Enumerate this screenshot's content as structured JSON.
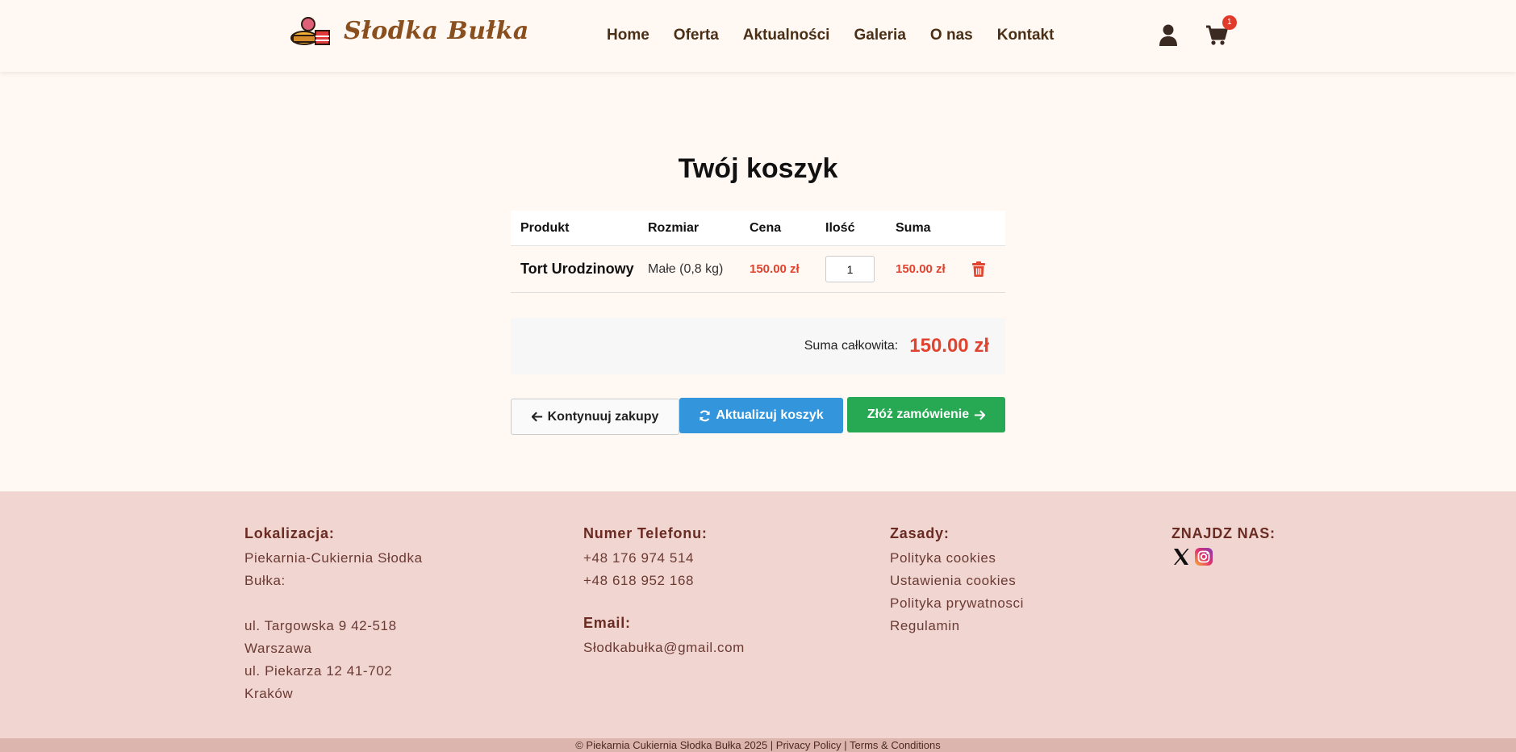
{
  "brand": {
    "name": "Słodka Bułka"
  },
  "nav": {
    "items": [
      "Home",
      "Oferta",
      "Aktualności",
      "Galeria",
      "O nas",
      "Kontakt"
    ]
  },
  "header": {
    "cart_count": "1"
  },
  "cart": {
    "title": "Twój koszyk",
    "columns": {
      "product": "Produkt",
      "size": "Rozmiar",
      "price": "Cena",
      "qty": "Ilość",
      "sum": "Suma"
    },
    "items": [
      {
        "name": "Tort Urodzinowy",
        "size": "Małe (0,8 kg)",
        "price": "150.00 zł",
        "qty": "1",
        "sum": "150.00 zł"
      }
    ],
    "total_label": "Suma całkowita:",
    "total_value": "150.00 zł",
    "buttons": {
      "continue": "Kontynuuj zakupy",
      "update": "Aktualizuj koszyk",
      "order": "Złóż zamówienie"
    }
  },
  "footer": {
    "location": {
      "heading": "Lokalizacja:",
      "lines": [
        "Piekarnia-Cukiernia Słodka",
        "Bułka:",
        "ul. Targowska 9 42-518",
        "Warszawa",
        "ul. Piekarza 12 41-702",
        "Kraków"
      ]
    },
    "phone": {
      "heading": "Numer Telefonu:",
      "lines": [
        "+48 176 974 514",
        "+48 618 952 168"
      ],
      "email_heading": "Email:",
      "email": "Słodkabułka@gmail.com"
    },
    "rules": {
      "heading": "Zasady:",
      "links": [
        "Polityka cookies",
        "Ustawienia cookies",
        "Polityka prywatnosci",
        "Regulamin"
      ]
    },
    "social": {
      "heading": "ZNAJDZ NAS:"
    },
    "copyright": "© Piekarnia Cukiernia Słodka Bułka 2025 | Privacy Policy | Terms & Conditions"
  },
  "colors": {
    "accent_red": "#e0442f",
    "update_blue": "#3396dc",
    "order_green": "#27a852",
    "footer_bg": "#f0d5d1",
    "brand_brown": "#8a4f1e"
  },
  "icons": [
    "bakery-logo-icon",
    "user-icon",
    "cart-icon",
    "trash-icon",
    "arrow-left-icon",
    "refresh-icon",
    "arrow-right-icon",
    "x-icon",
    "instagram-icon"
  ]
}
